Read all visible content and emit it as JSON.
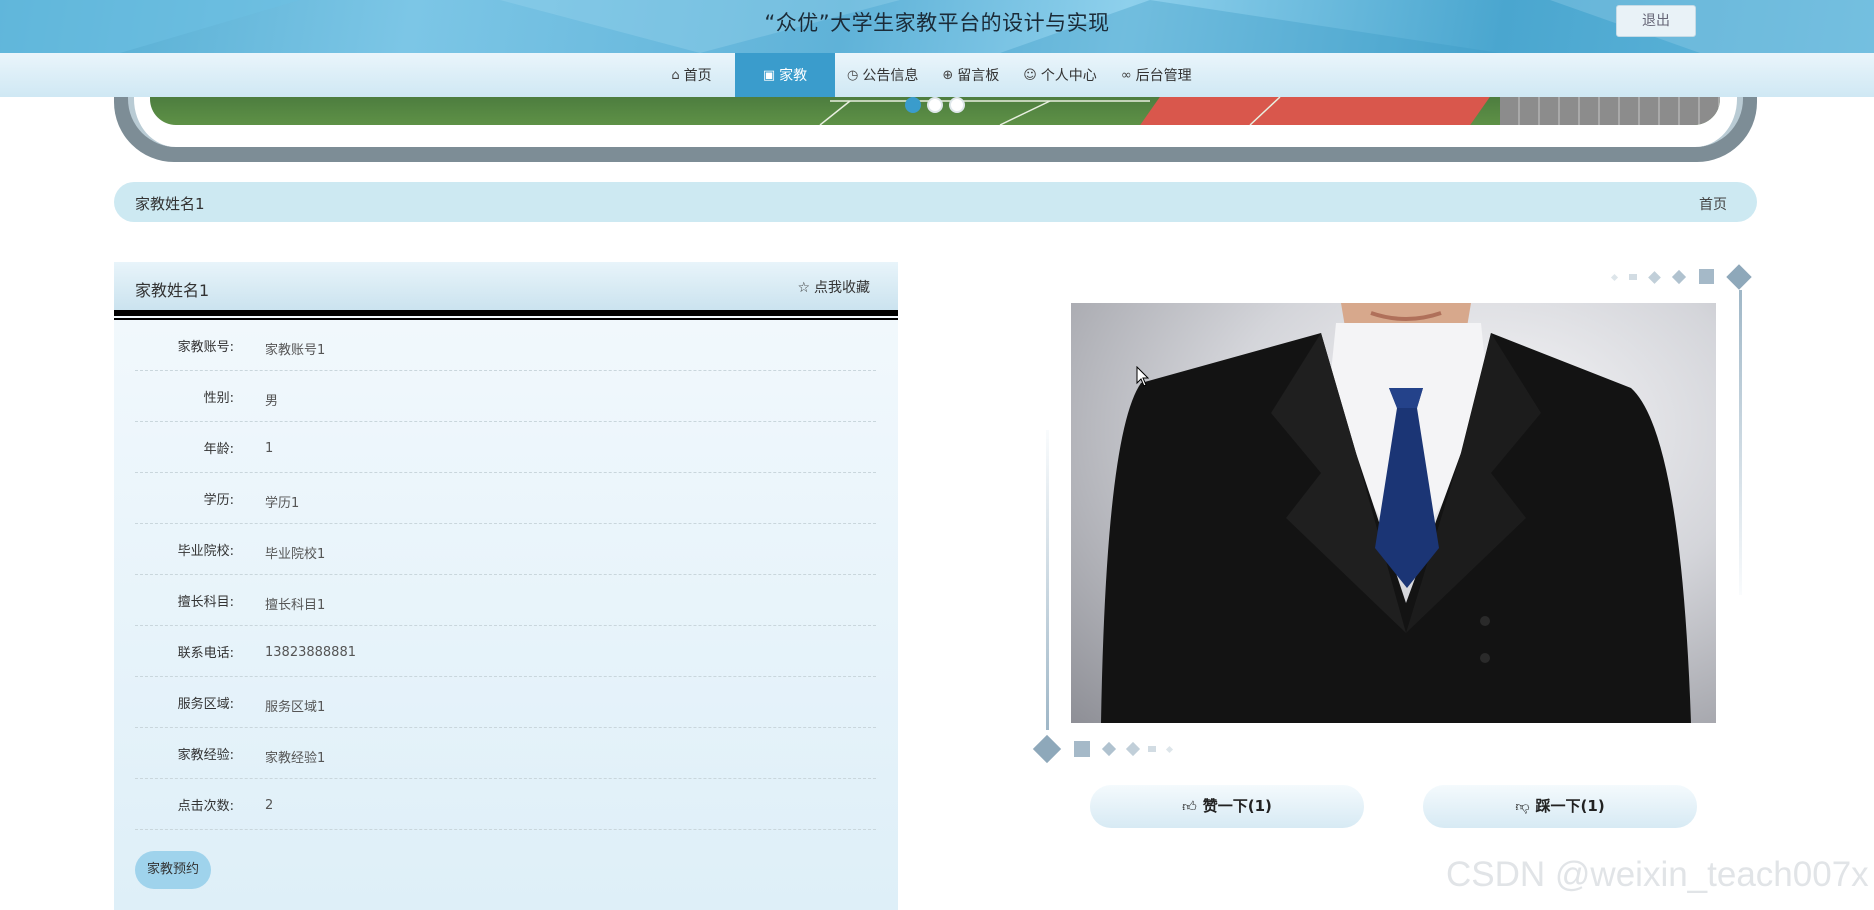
{
  "header": {
    "title": "“众优”大学生家教平台的设计与实现",
    "logout_label": "退出"
  },
  "nav": {
    "items": [
      {
        "label": "首页",
        "icon": "home-icon"
      },
      {
        "label": "家教",
        "icon": "gift-icon",
        "active": true
      },
      {
        "label": "公告信息",
        "icon": "clock-icon"
      },
      {
        "label": "留言板",
        "icon": "globe-icon"
      },
      {
        "label": "个人中心",
        "icon": "user-icon"
      },
      {
        "label": "后台管理",
        "icon": "link-icon"
      }
    ]
  },
  "carousel": {
    "slides": 3,
    "active": 1
  },
  "breadcrumb": {
    "title": "家教姓名1",
    "home": "首页"
  },
  "detail": {
    "name": "家教姓名1",
    "favorite_label": "点我收藏",
    "fields": [
      {
        "label": "家教账号:",
        "value": "家教账号1"
      },
      {
        "label": "性别:",
        "value": "男"
      },
      {
        "label": "年龄:",
        "value": "1"
      },
      {
        "label": "学历:",
        "value": "学历1"
      },
      {
        "label": "毕业院校:",
        "value": "毕业院校1"
      },
      {
        "label": "擅长科目:",
        "value": "擅长科目1"
      },
      {
        "label": "联系电话:",
        "value": "13823888881"
      },
      {
        "label": "服务区域:",
        "value": "服务区域1"
      },
      {
        "label": "家教经验:",
        "value": "家教经验1"
      },
      {
        "label": "点击次数:",
        "value": "2"
      }
    ],
    "book_label": "家教预约"
  },
  "votes": {
    "like_label": "赞一下(1)",
    "dislike_label": "踩一下(1)"
  },
  "watermark": "CSDN @weixin_teach007x",
  "colors": {
    "accent": "#3a9ccc",
    "header": "#5fb2d8",
    "panel": "#e6f3fa"
  }
}
